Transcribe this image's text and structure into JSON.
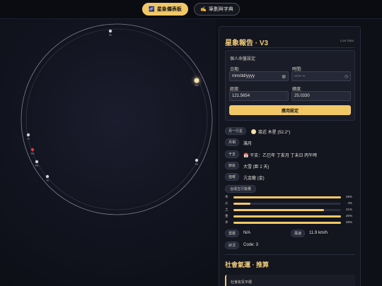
{
  "tabs": [
    {
      "icon": "🌌",
      "label": "星象儀表板"
    },
    {
      "icon": "✍️",
      "label": "筆劃與字典"
    }
  ],
  "sky": {
    "planets": [
      {
        "name": "Su",
        "color": "#cfd0d6"
      },
      {
        "name": "Mo",
        "color": "#f6dfaa"
      },
      {
        "name": "Ju",
        "color": "#cfd0d6"
      },
      {
        "name": "Ma",
        "color": "#e03a3a"
      },
      {
        "name": "Me",
        "color": "#cfd0d6"
      },
      {
        "name": "Ve",
        "color": "#cfd0d6"
      },
      {
        "name": "Sa",
        "color": "#cfd0d6"
      }
    ]
  },
  "panel": {
    "title": "星象報告 · V3",
    "live_label": "Live Data",
    "settings": {
      "title": "個人命盤設定",
      "date_label": "日期:",
      "date_placeholder": "mm/dd/yyyy",
      "time_label": "時間:",
      "time_placeholder": "--:-- --",
      "longitude_label": "經度:",
      "longitude_value": "121.5654",
      "latitude_label": "緯度:",
      "latitude_value": "25.0330",
      "apply_label": "應用設定"
    },
    "info": {
      "moon_planet_chip": "月一行星",
      "moon_planet_value": "接近 木星 (52.2°)",
      "moon_phase_chip": "月相",
      "moon_phase_value": "滿月",
      "ganzhi_chip": "干支",
      "ganzhi_icon": "📅",
      "ganzhi_value": "干支：乙巳年 丁亥月 丁未日 丙午時",
      "solar_term_chip": "節氣",
      "solar_term_value": "大雪 (距 2 天)",
      "daygod_chip": "值曜",
      "daygod_value": "亢金龍 (金)"
    },
    "elements_chip": "合成五行能量",
    "elements": [
      {
        "name": "木",
        "percent": 25,
        "label": "25%"
      },
      {
        "name": "火",
        "percent": 4,
        "label": "4%"
      },
      {
        "name": "土",
        "percent": 21,
        "label": "21%"
      },
      {
        "name": "金",
        "percent": 25,
        "label": "25%"
      },
      {
        "name": "水",
        "percent": 25,
        "label": "25%"
      }
    ],
    "weather": {
      "cloud_chip": "雲層",
      "cloud_value": "N/A",
      "wind_chip": "風速",
      "wind_value": "11.9 km/h",
      "status_chip": "狀況",
      "status_value": "Code: 3"
    },
    "social_title": "社會氣運 · 推算",
    "social_card_label": "社會氣氛平穩"
  },
  "colors": {
    "accent": "#f2c867",
    "title": "#f2cd7a",
    "bg": "#0e1018"
  }
}
